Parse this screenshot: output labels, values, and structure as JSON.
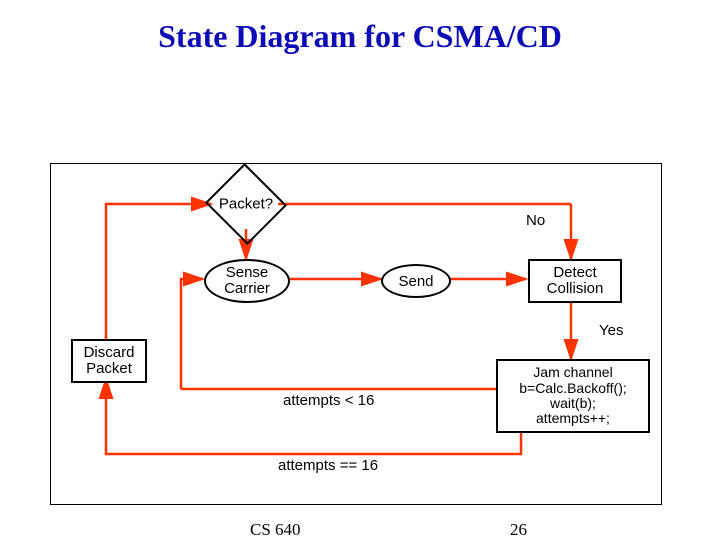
{
  "title": "State Diagram for CSMA/CD",
  "footer": {
    "course": "CS 640",
    "page": "26"
  },
  "nodes": {
    "packet": "Packet?",
    "sense": "Sense\nCarrier",
    "send": "Send",
    "detect": "Detect\nCollision",
    "jam": "Jam channel\nb=Calc.Backoff();\nwait(b);\nattempts++;",
    "discard": "Discard\nPacket"
  },
  "labels": {
    "no": "No",
    "yes": "Yes",
    "lt16": "attempts < 16",
    "eq16": "attempts == 16"
  }
}
